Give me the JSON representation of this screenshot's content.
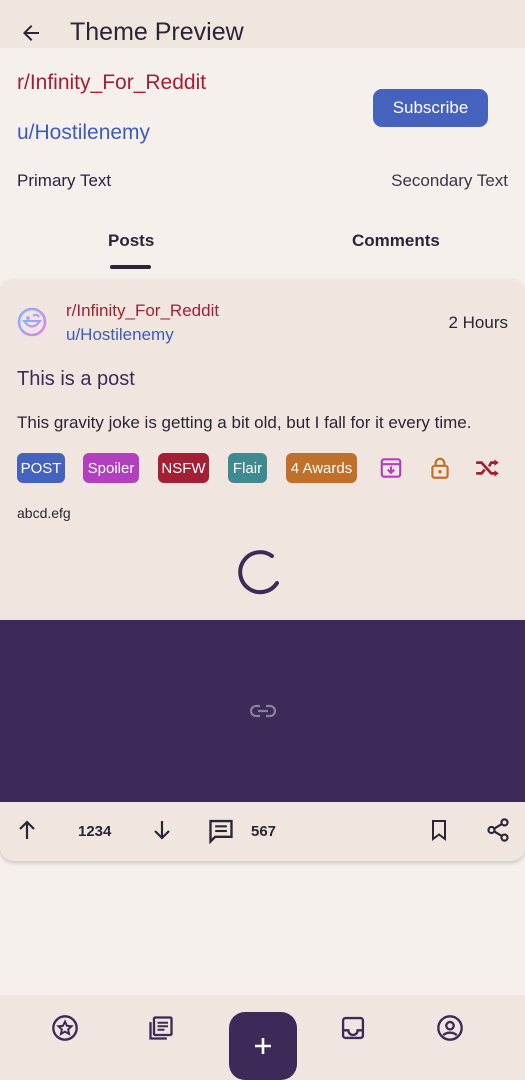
{
  "app_bar": {
    "title": "Theme Preview",
    "back_icon": "arrow-left-icon"
  },
  "header": {
    "subreddit": "r/Infinity_For_Reddit",
    "username": "u/Hostilenemy",
    "subscribe_label": "Subscribe",
    "primary_text": "Primary Text",
    "secondary_text": "Secondary Text"
  },
  "tabs": [
    {
      "label": "Posts",
      "selected": true
    },
    {
      "label": "Comments",
      "selected": false
    }
  ],
  "post": {
    "subreddit": "r/Infinity_For_Reddit",
    "author": "u/Hostilenemy",
    "time": "2 Hours",
    "title": "This is a post",
    "body": "This gravity joke is getting a bit old, but I fall for it every time.",
    "chips": {
      "post": "POST",
      "spoiler": "Spoiler",
      "nsfw": "NSFW",
      "flair": "Flair",
      "awards": "4 Awards"
    },
    "domain": "abcd.efg",
    "score": "1234",
    "comments": "567"
  },
  "colors": {
    "subreddit": "#a31f36",
    "username": "#3d5bbf",
    "accent": "#4562bf",
    "link_preview_bg": "#3c2b58",
    "card_bg": "#f0e6df"
  },
  "bottom_nav": {
    "items": [
      "star-circle-icon",
      "newspaper-icon",
      "inbox-icon",
      "account-circle-icon"
    ],
    "fab": "plus-icon"
  }
}
